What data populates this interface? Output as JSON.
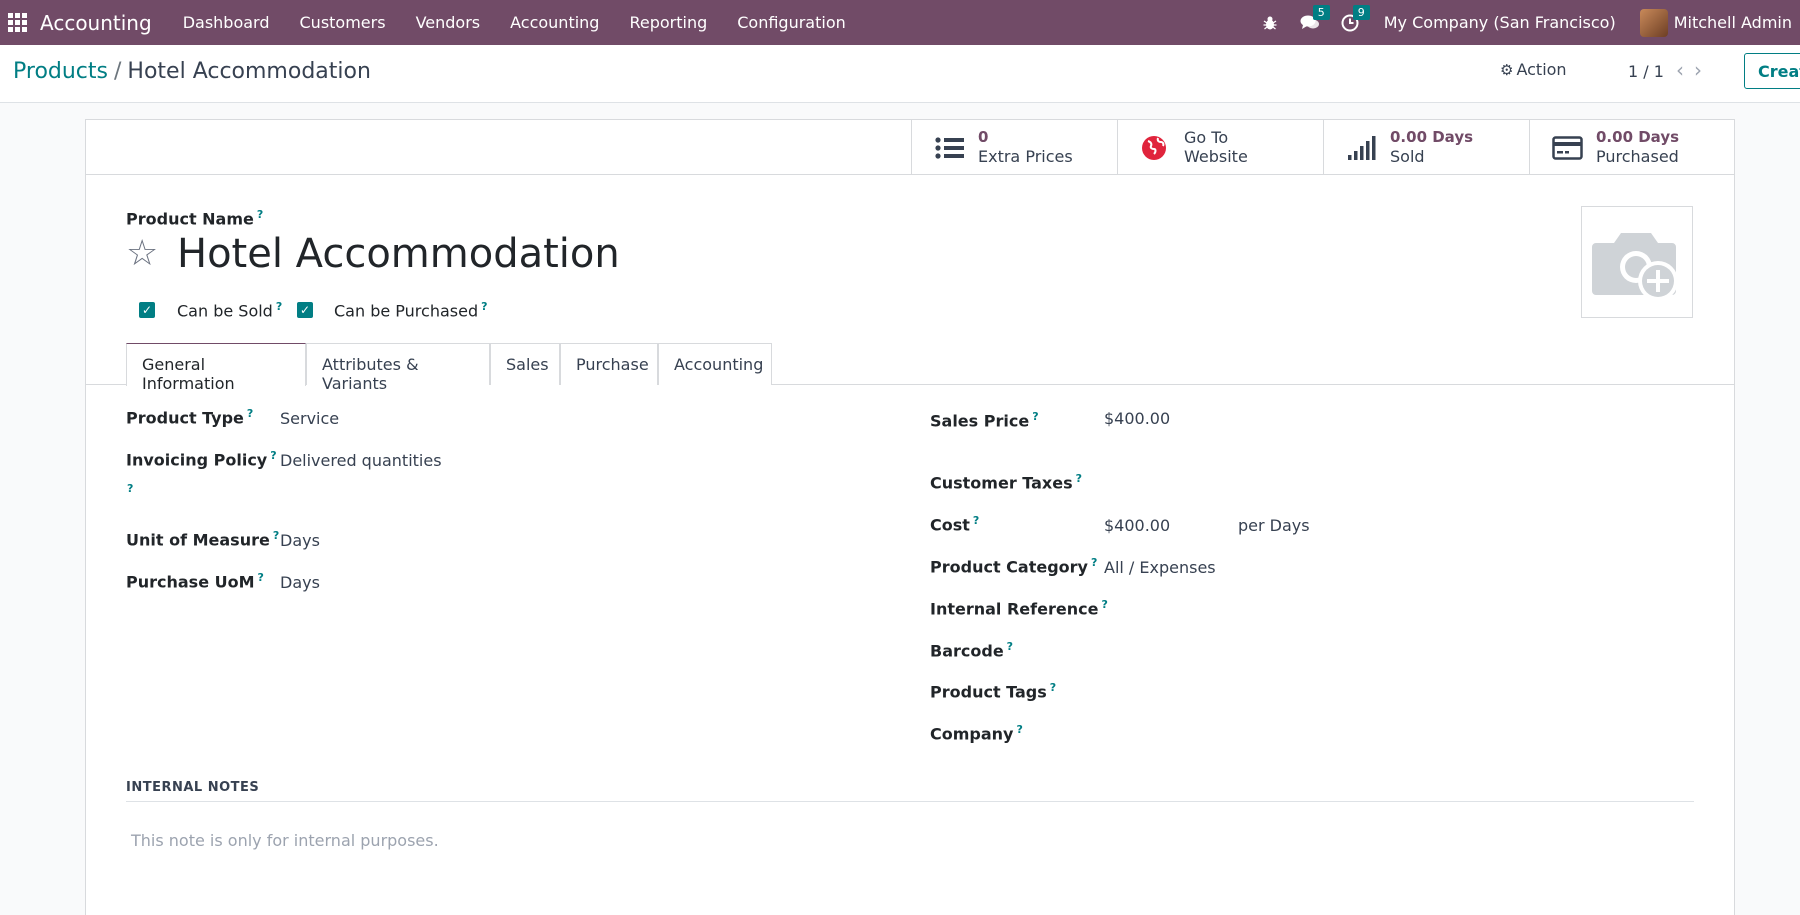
{
  "topnav": {
    "brand": "Accounting",
    "menu": [
      "Dashboard",
      "Customers",
      "Vendors",
      "Accounting",
      "Reporting",
      "Configuration"
    ],
    "messages_count": "5",
    "activities_count": "9",
    "company": "My Company (San Francisco)",
    "user": "Mitchell Admin"
  },
  "breadcrumb": {
    "parent": "Products",
    "separator": "/",
    "current": "Hotel Accommodation"
  },
  "control": {
    "action_label": "Action",
    "pager": "1 / 1",
    "create_label": "Creat"
  },
  "stat_buttons": [
    {
      "value": "0",
      "label": "Extra Prices",
      "icon": "list-icon"
    },
    {
      "value": "Go To",
      "label": "Website",
      "icon": "globe-icon"
    },
    {
      "value": "0.00 Days",
      "label": "Sold",
      "icon": "signal-icon"
    },
    {
      "value": "0.00 Days",
      "label": "Purchased",
      "icon": "credit-card-icon"
    }
  ],
  "product": {
    "name_label": "Product Name",
    "name": "Hotel Accommodation",
    "can_be_sold_label": "Can be Sold",
    "can_be_sold": true,
    "can_be_purchased_label": "Can be Purchased",
    "can_be_purchased": true
  },
  "tabs": [
    "General Information",
    "Attributes & Variants",
    "Sales",
    "Purchase",
    "Accounting"
  ],
  "left_fields": {
    "product_type_label": "Product Type",
    "product_type": "Service",
    "invoicing_policy_label": "Invoicing Policy",
    "invoicing_policy": "Delivered quantities",
    "uom_label": "Unit of Measure",
    "uom": "Days",
    "purchase_uom_label": "Purchase UoM",
    "purchase_uom": "Days"
  },
  "right_fields": {
    "sales_price_label": "Sales Price",
    "sales_price": "$400.00",
    "customer_taxes_label": "Customer Taxes",
    "cost_label": "Cost",
    "cost": "$400.00",
    "cost_unit": "per Days",
    "category_label": "Product Category",
    "category": "All / Expenses",
    "internal_ref_label": "Internal Reference",
    "barcode_label": "Barcode",
    "tags_label": "Product Tags",
    "company_label": "Company"
  },
  "notes": {
    "title": "INTERNAL NOTES",
    "placeholder": "This note is only for internal purposes."
  },
  "help_mark": "?",
  "colors": {
    "brand": "#714b67",
    "accent": "#017e84"
  }
}
